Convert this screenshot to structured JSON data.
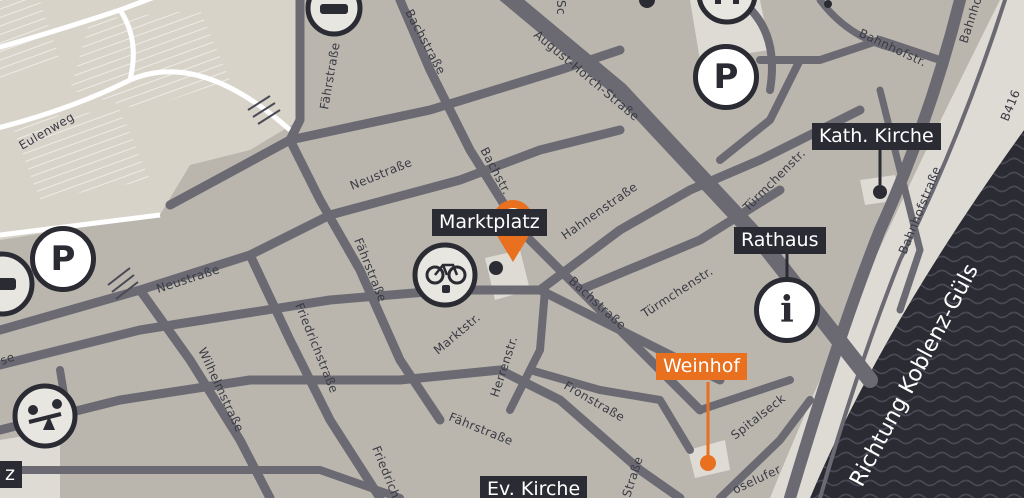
{
  "map": {
    "streets": {
      "eulenweg": "Eulenweg",
      "faehrstrasse_top": "Fährstraße",
      "bachstrasse_top": "Bachstraße",
      "august_horch": "August-Horch-Straße",
      "bahnhofstr": "Bahnhofstr.",
      "bahnhofstrasse": "Bahnhofstraße",
      "bahnho_cut": "Bahnho",
      "neustrasse_1": "Neustraße",
      "neustrasse_2": "Neustraße",
      "bachstr": "Bachstr.",
      "hahnenstrasse": "Hahnenstraße",
      "tuermchenstr_1": "Türmchenstr.",
      "tuermchenstr_2": "Türmchenstr.",
      "bachstrasse_mid": "Bachstraße",
      "marktstr": "Marktstr.",
      "faehrstrasse_mid": "Fährstraße",
      "friedrichstrasse": "Friedrichstraße",
      "wilhelmstrasse": "Wilhelmstraße",
      "herrenstr": "Herrenstr.",
      "fronstrasse": "Fronstraße",
      "faehrstrasse_low": "Fährstraße",
      "friedrich_cut": "Friedrich",
      "strasse_cut": "Straße",
      "spitalseck": "Spitalseck",
      "moselufer_cut": "oselufer",
      "se_cut": "se",
      "b416": "B416",
      "sc_cut": "Sc"
    },
    "river_label": "Richtung Koblenz-Güls",
    "poi": {
      "marktplatz": "Marktplatz",
      "kath_kirche": "Kath. Kirche",
      "rathaus": "Rathaus",
      "weinhof": "Weinhof",
      "ev_kirche": "Ev. Kirche",
      "z_cut": "z"
    },
    "icons": {
      "parking_glyph": "P",
      "info_glyph": "i"
    },
    "colors": {
      "accent": "#e8701f",
      "dark": "#2b2b33",
      "road": "#6b6a72",
      "block": "#bab6ae",
      "open_land": "#d8d3c9",
      "river": "#2b2b33"
    }
  }
}
